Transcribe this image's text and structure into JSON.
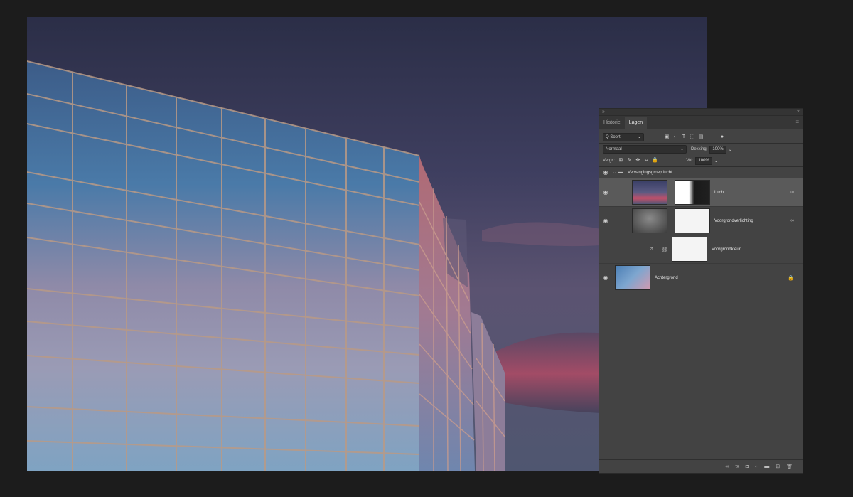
{
  "panel": {
    "tabs": [
      {
        "label": "Historie",
        "active": false
      },
      {
        "label": "Lagen",
        "active": true
      }
    ],
    "filter": {
      "label": "Q Soort"
    },
    "blend_mode": "Normaal",
    "opacity_label": "Dekking:",
    "opacity_value": "100%",
    "lock_label": "Vergr.:",
    "fill_label": "Vul:",
    "fill_value": "100%",
    "group": {
      "name": "Vervangingsgroep lucht"
    },
    "layers": [
      {
        "name": "Lucht",
        "selected": true
      },
      {
        "name": "Voorgrondverlichting",
        "selected": false
      },
      {
        "name": "Voorgrondkleur",
        "selected": false
      },
      {
        "name": "Achtergrond",
        "selected": false
      }
    ],
    "icons": {
      "filter_icons": [
        "image-icon",
        "adjustment-icon",
        "type-icon",
        "shape-icon",
        "smartobject-icon"
      ],
      "lock_icons": [
        "lock-pixels-icon",
        "lock-paint-icon",
        "lock-move-icon",
        "lock-artboard-icon",
        "lock-all-icon"
      ],
      "bottom_icons": [
        "link-icon",
        "fx-icon",
        "mask-icon",
        "adjustment-layer-icon",
        "folder-icon",
        "new-layer-icon",
        "trash-icon"
      ]
    }
  },
  "colors": {
    "app_background": "#1c1c1c",
    "panel_background": "#434343",
    "selected_layer": "#5a5a5a"
  }
}
